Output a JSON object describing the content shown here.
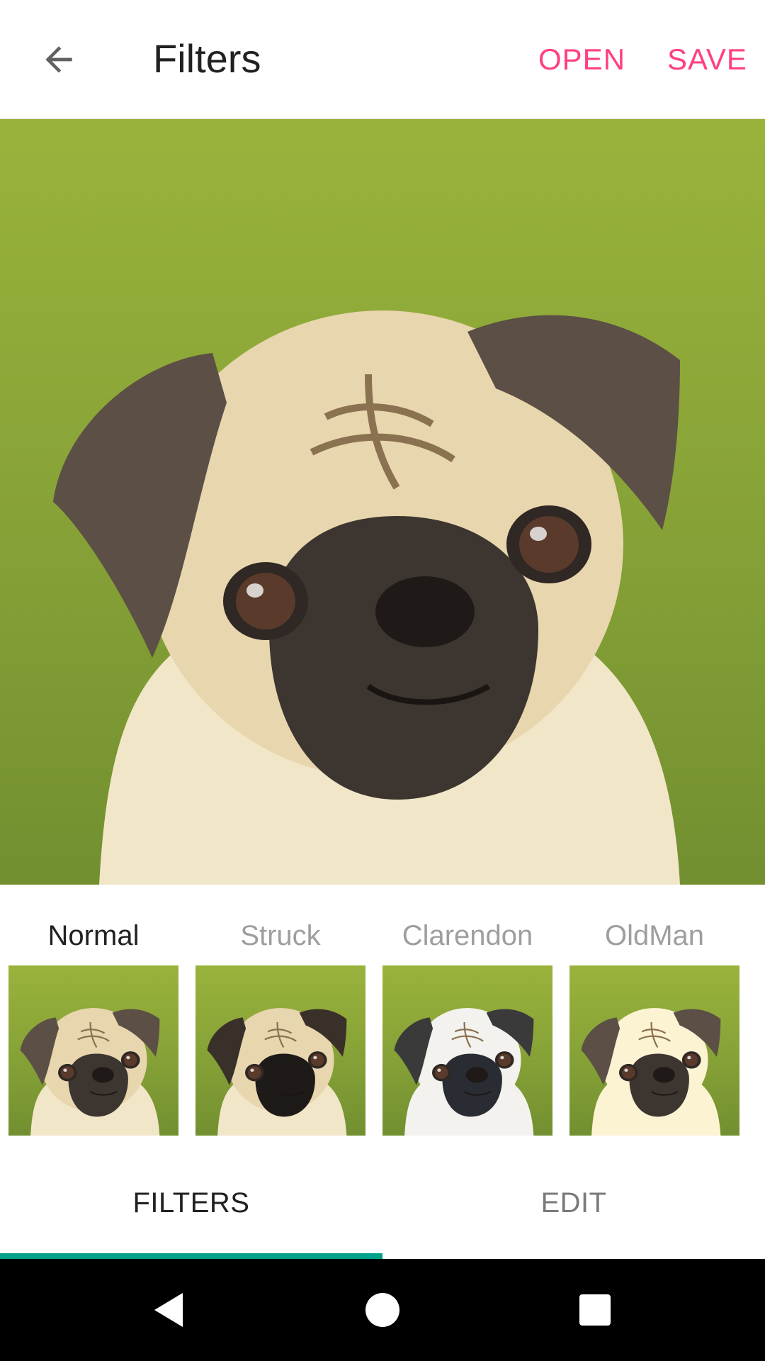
{
  "toolbar": {
    "title": "Filters",
    "open_label": "OPEN",
    "save_label": "SAVE",
    "back_icon": "arrow-back-icon"
  },
  "photo": {
    "subject": "pug"
  },
  "filters": [
    {
      "label": "Normal",
      "selected": true
    },
    {
      "label": "Struck",
      "selected": false
    },
    {
      "label": "Clarendon",
      "selected": false
    },
    {
      "label": "OldMan",
      "selected": false
    }
  ],
  "tabs": [
    {
      "label": "FILTERS",
      "selected": true
    },
    {
      "label": "EDIT",
      "selected": false
    }
  ],
  "navbar": {
    "back_icon": "nav-back-icon",
    "home_icon": "nav-home-icon",
    "recents_icon": "nav-recents-icon"
  },
  "colors": {
    "accent": "#ff4081",
    "tab_indicator": "#00a08a",
    "title_text": "#212121",
    "inactive_text": "#9e9e9e"
  }
}
